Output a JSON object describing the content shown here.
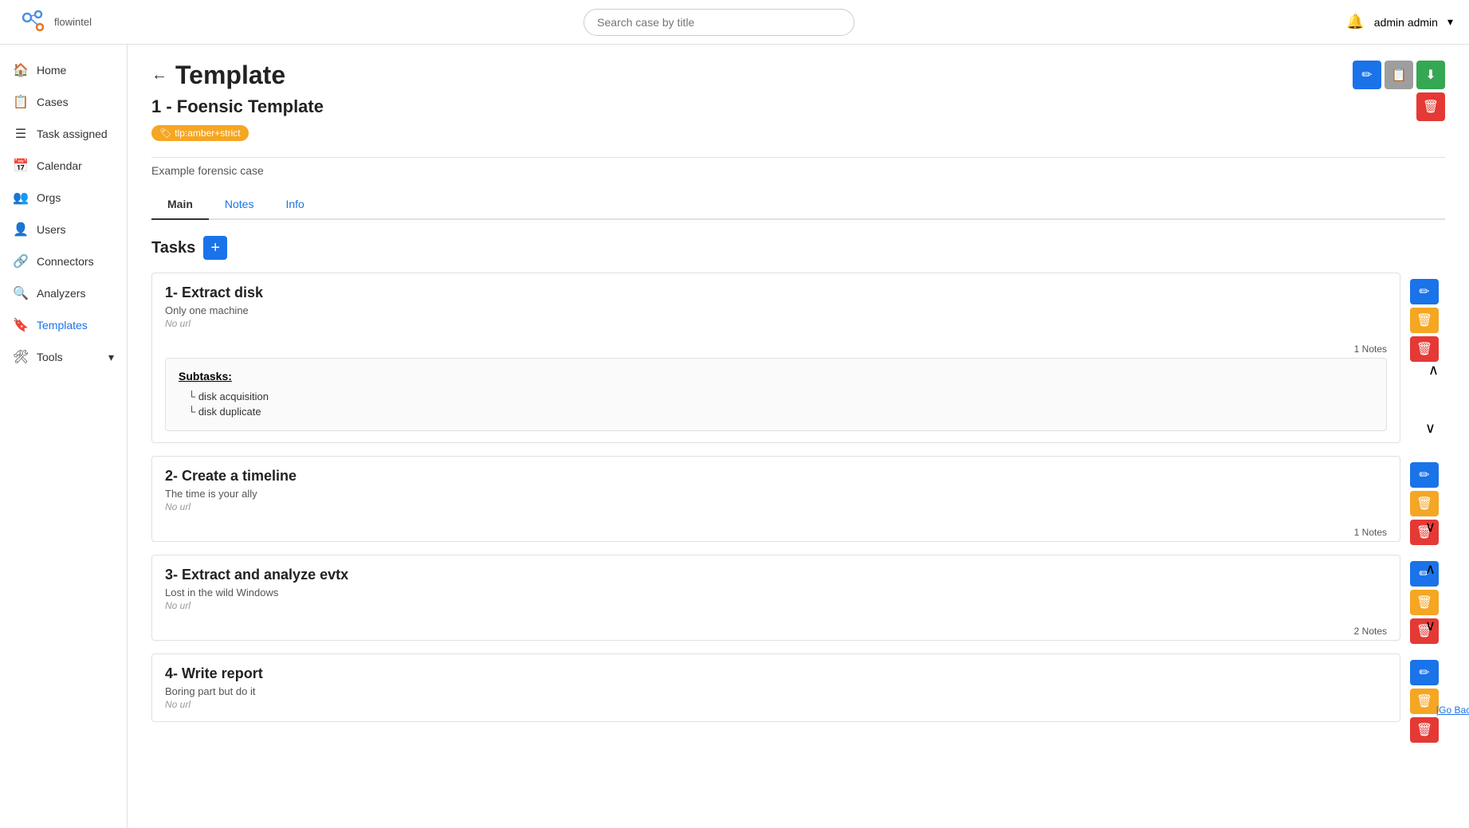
{
  "topbar": {
    "logo_text": "flowintel",
    "search_placeholder": "Search case by title",
    "user_label": "admin admin",
    "bell_icon": "🔔",
    "chevron_icon": "▾"
  },
  "sidebar": {
    "items": [
      {
        "id": "home",
        "label": "Home",
        "icon": "🏠"
      },
      {
        "id": "cases",
        "label": "Cases",
        "icon": "📋"
      },
      {
        "id": "task-assigned",
        "label": "Task assigned",
        "icon": "☰"
      },
      {
        "id": "calendar",
        "label": "Calendar",
        "icon": "📅"
      },
      {
        "id": "orgs",
        "label": "Orgs",
        "icon": "👥"
      },
      {
        "id": "users",
        "label": "Users",
        "icon": "👤"
      },
      {
        "id": "connectors",
        "label": "Connectors",
        "icon": "🔗"
      },
      {
        "id": "analyzers",
        "label": "Analyzers",
        "icon": "🔍"
      },
      {
        "id": "templates",
        "label": "Templates",
        "icon": "🔖",
        "active": true
      },
      {
        "id": "tools",
        "label": "Tools",
        "icon": "🛠",
        "chevron": "▾"
      }
    ]
  },
  "page": {
    "back_arrow": "←",
    "title": "Template",
    "template_name": "1 - Foensic Template",
    "tag_label": "tlp:amber+strict",
    "description": "Example forensic case",
    "tabs": [
      {
        "id": "main",
        "label": "Main",
        "active": true
      },
      {
        "id": "notes",
        "label": "Notes"
      },
      {
        "id": "info",
        "label": "Info"
      }
    ],
    "tasks_title": "Tasks",
    "add_btn_label": "+",
    "top_actions": {
      "edit_icon": "✏",
      "copy_icon": "📋",
      "download_icon": "⬇",
      "delete_icon": "🗑"
    }
  },
  "tasks": [
    {
      "id": 1,
      "title": "1- Extract disk",
      "desc": "Only one machine",
      "url": "No url",
      "notes_count": "1 Notes",
      "expanded": true,
      "subtasks": {
        "title": "Subtasks:",
        "items": [
          "disk acquisition",
          "disk duplicate"
        ]
      }
    },
    {
      "id": 2,
      "title": "2- Create a timeline",
      "desc": "The time is your ally",
      "url": "No url",
      "notes_count": "1 Notes",
      "expanded": false
    },
    {
      "id": 3,
      "title": "3- Extract and analyze evtx",
      "desc": "Lost in the wild Windows",
      "url": "No url",
      "notes_count": "2 Notes",
      "expanded": false
    },
    {
      "id": 4,
      "title": "4- Write report",
      "desc": "Boring part but do it",
      "url": "No url",
      "notes_count": "",
      "expanded": false
    }
  ],
  "go_back_top": "[Go Back Top]"
}
